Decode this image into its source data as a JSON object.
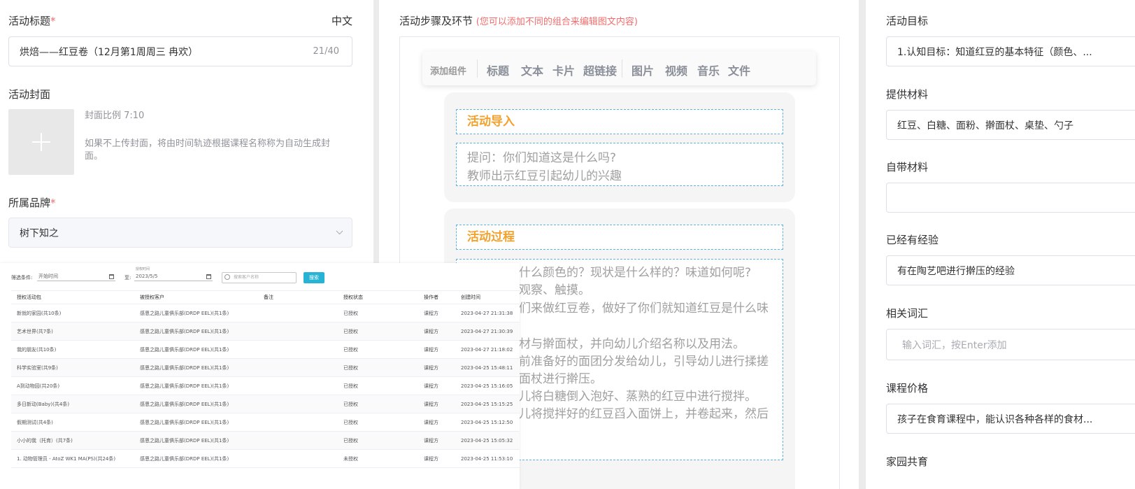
{
  "left": {
    "title_label": "活动标题",
    "required_mark": "*",
    "language": "中文",
    "title_value": "烘焙——红豆卷（12月第1周周三  冉欢）",
    "title_counter": "21/40",
    "cover_label": "活动封面",
    "cover_ratio": "封面比例 7:10",
    "cover_hint_1": "如果不上传封面，将由时间轨迹根据课程名称称为自动生成封",
    "cover_hint_2": "面。",
    "brand_label": "所属品牌",
    "brand_value": "树下知之"
  },
  "overlay": {
    "filter_label": "筛选条件:",
    "start_placeholder": "开始时间",
    "to_label": "至:",
    "end_caption": "授权时间",
    "end_value": "2023/5/5",
    "search_placeholder": "搜索客户名称",
    "search_button": "搜索",
    "headers": [
      "授权活动包",
      "被授权客户",
      "备注",
      "授权状态",
      "操作者",
      "创建时间"
    ],
    "rows": [
      [
        "新就的家园(共10条)",
        "感恩之路儿童俱乐部(DRDP EEL)(共1条)",
        "",
        "已授权",
        "课程方",
        "2023-04-27 21:31:38"
      ],
      [
        "艺术世界(共7条)",
        "感恩之路儿童俱乐部(DRDP EEL)(共1条)",
        "",
        "已授权",
        "课程方",
        "2023-04-27 21:30:39"
      ],
      [
        "我的朋友(共10条)",
        "感恩之路儿童俱乐部(DRDP EEL)(共1条)",
        "",
        "已授权",
        "课程方",
        "2023-04-27 21:18:02"
      ],
      [
        "科学实验室(共9条)",
        "感恩之路儿童俱乐部(DRDP EEL)(共1条)",
        "",
        "已授权",
        "课程方",
        "2023-04-25 15:48:11"
      ],
      [
        "A到动物园(共20条)",
        "感恩之路儿童俱乐部(DRDP EEL)(共1条)",
        "",
        "已授权",
        "课程方",
        "2023-04-25 15:16:05"
      ],
      [
        "多日新动(Baby)(共4条)",
        "感恩之路儿童俱乐部(DRDP EEL)(共1条)",
        "",
        "已授权",
        "课程方",
        "2023-04-25 15:15:25"
      ],
      [
        "假期测试(共4条)",
        "感恩之路儿童俱乐部(DRDP EEL)(共1条)",
        "",
        "已授权",
        "课程方",
        "2023-04-25 15:12:50"
      ],
      [
        "小小的我（托育）(共7条)",
        "感恩之路儿童俱乐部(DRDP EEL)(共1条)",
        "",
        "已授权",
        "课程方",
        "2023-04-25 15:05:32"
      ],
      [
        "1. 动物管理员 - AtoZ  WK1 MA(PS)(共24条)",
        "感恩之路儿童俱乐部(DRDP EEL)(共1条)",
        "",
        "未授权",
        "课程方",
        "2023-04-25 11:53:10"
      ]
    ]
  },
  "middle": {
    "section_label": "活动步骤及环节",
    "section_hint": "(您可以添加不同的组合来编辑图文内容)",
    "toolbar": {
      "add_component": "添加组件",
      "group1": [
        "标题",
        "文本",
        "卡片",
        "超链接"
      ],
      "group2": [
        "图片",
        "视频",
        "音乐",
        "文件"
      ]
    },
    "card1": {
      "title": "活动导入",
      "lines": [
        "提问：你们知道这是什么吗?",
        "教师出示红豆引起幼儿的兴趣"
      ]
    },
    "card2": {
      "title": "活动过程",
      "lines": [
        "什么颜色的？现状是什么样的？味道如何呢?",
        "观察、触摸。",
        "们来做红豆卷，做好了你们就知道红豆是什么味",
        "",
        "材与擀面杖，并向幼儿介绍名称以及用法。",
        "前准备好的面团分发给幼儿，引导幼儿进行揉搓",
        "面杖进行擀压。",
        "儿将白糖倒入泡好、蒸熟的红豆中进行搅拌。",
        "儿将搅拌好的红豆舀入面饼上，并卷起来，然后"
      ]
    }
  },
  "right": {
    "goal_label": "活动目标",
    "goal_value": "1.认知目标：知道红豆的基本特征（颜色、...",
    "materials_label": "提供材料",
    "materials_value": "红豆、白糖、面粉、擀面杖、桌垫、勺子",
    "self_materials_label": "自带材料",
    "self_materials_value": "",
    "experience_label": "已经有经验",
    "experience_value": "有在陶艺吧进行擀压的经验",
    "vocab_label": "相关词汇",
    "vocab_placeholder": "输入词汇，按Enter添加",
    "price_label": "课程价格",
    "price_value": "孩子在食育课程中，能认识各种各样的食材...",
    "home_label": "家园共育"
  }
}
